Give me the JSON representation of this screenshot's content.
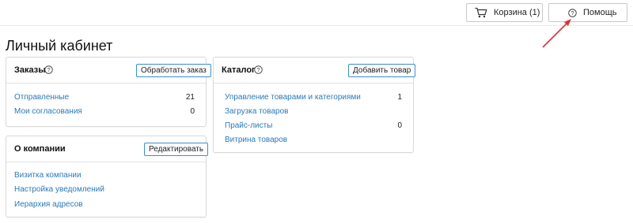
{
  "topbar": {
    "cart_label": "Корзина (1)",
    "help_label": "Помощь"
  },
  "page_title": "Личный кабинет",
  "orders": {
    "title": "Заказы",
    "button": "Обработать заказ",
    "items": [
      {
        "label": "Отправленные",
        "count": "21"
      },
      {
        "label": "Мои согласования",
        "count": "0"
      }
    ]
  },
  "catalog": {
    "title": "Каталог",
    "button": "Добавить товар",
    "items": [
      {
        "label": "Управление товарами и категориями",
        "count": "1"
      },
      {
        "label": "Загрузка товаров",
        "count": ""
      },
      {
        "label": "Прайс-листы",
        "count": "0"
      },
      {
        "label": "Витрина товаров",
        "count": ""
      }
    ]
  },
  "company": {
    "title": "О компании",
    "button": "Редактировать",
    "items": [
      {
        "label": "Визитка компании"
      },
      {
        "label": "Настройка уведомлений"
      },
      {
        "label": "Иерархия адресов"
      }
    ]
  },
  "colors": {
    "link": "#2a7ab9",
    "button_border": "#3b8fd0",
    "annotation_arrow": "#e03030"
  },
  "icons": {
    "cart": "cart-icon",
    "help": "question-circle-icon",
    "annotation": "red-arrow-icon"
  }
}
